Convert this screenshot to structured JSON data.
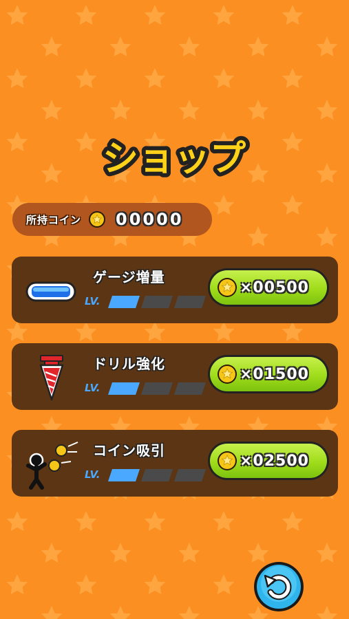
{
  "screen": {
    "title": "ショップ",
    "background_color": "#fb8f22",
    "star_color": "#ffa540"
  },
  "coin_bar": {
    "label": "所持コイン",
    "count": "00000",
    "icon": "coin-icon"
  },
  "shop_items": [
    {
      "name": "ゲージ増量",
      "icon": "gauge-bar-icon",
      "lv_label": "LV.",
      "level": 1,
      "max_level": 3,
      "price": "×00500"
    },
    {
      "name": "ドリル強化",
      "icon": "drill-icon",
      "lv_label": "LV.",
      "level": 1,
      "max_level": 3,
      "price": "×01500"
    },
    {
      "name": "コイン吸引",
      "icon": "coin-magnet-icon",
      "lv_label": "LV.",
      "level": 1,
      "max_level": 3,
      "price": "×02500"
    }
  ],
  "back_button": {
    "icon": "back-arrow-icon"
  },
  "colors": {
    "panel": "#5c3614",
    "buy_button": "#9fdc1a",
    "level_filled": "#4aa9ff",
    "level_empty": "#4a4a4a",
    "coin": "#f5c518"
  }
}
